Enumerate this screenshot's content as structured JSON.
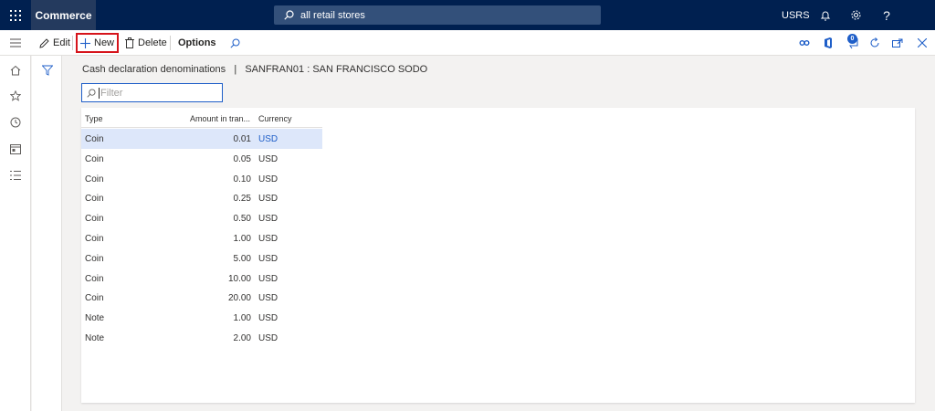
{
  "app": {
    "name": "Commerce",
    "search_text": "all retail stores",
    "company": "USRS"
  },
  "topbar_icons": [
    "waffle-icon",
    "bell-icon",
    "gear-icon",
    "help-icon"
  ],
  "actions": {
    "edit": "Edit",
    "new": "New",
    "delete": "Delete",
    "options": "Options"
  },
  "toolbar_icons": [
    "search-icon",
    "link-icon",
    "office-icon",
    "attachments-icon",
    "refresh-icon",
    "open-new-window-icon",
    "close-icon"
  ],
  "attachments_count": "0",
  "nav_icons": [
    "hamburger-icon",
    "home-icon",
    "star-icon",
    "clock-icon",
    "workspace-icon",
    "list-icon"
  ],
  "page": {
    "caption": "Cash declaration denominations   |   SANFRAN01 : SAN FRANCISCO SODO",
    "filter_placeholder": "Filter"
  },
  "grid": {
    "columns": [
      "Type",
      "Amount in tran...",
      "Currency"
    ],
    "rows": [
      {
        "type": "Coin",
        "amount": "0.01",
        "currency": "USD",
        "selected": true
      },
      {
        "type": "Coin",
        "amount": "0.05",
        "currency": "USD"
      },
      {
        "type": "Coin",
        "amount": "0.10",
        "currency": "USD"
      },
      {
        "type": "Coin",
        "amount": "0.25",
        "currency": "USD"
      },
      {
        "type": "Coin",
        "amount": "0.50",
        "currency": "USD"
      },
      {
        "type": "Coin",
        "amount": "1.00",
        "currency": "USD"
      },
      {
        "type": "Coin",
        "amount": "5.00",
        "currency": "USD"
      },
      {
        "type": "Coin",
        "amount": "10.00",
        "currency": "USD"
      },
      {
        "type": "Coin",
        "amount": "20.00",
        "currency": "USD"
      },
      {
        "type": "Note",
        "amount": "1.00",
        "currency": "USD"
      },
      {
        "type": "Note",
        "amount": "2.00",
        "currency": "USD"
      }
    ]
  },
  "colors": {
    "topbar": "#002050",
    "brand_bg": "#243a5e",
    "accent": "#1e5ec8",
    "selected_row": "#dde7fa",
    "highlight_box": "#d6141b"
  }
}
